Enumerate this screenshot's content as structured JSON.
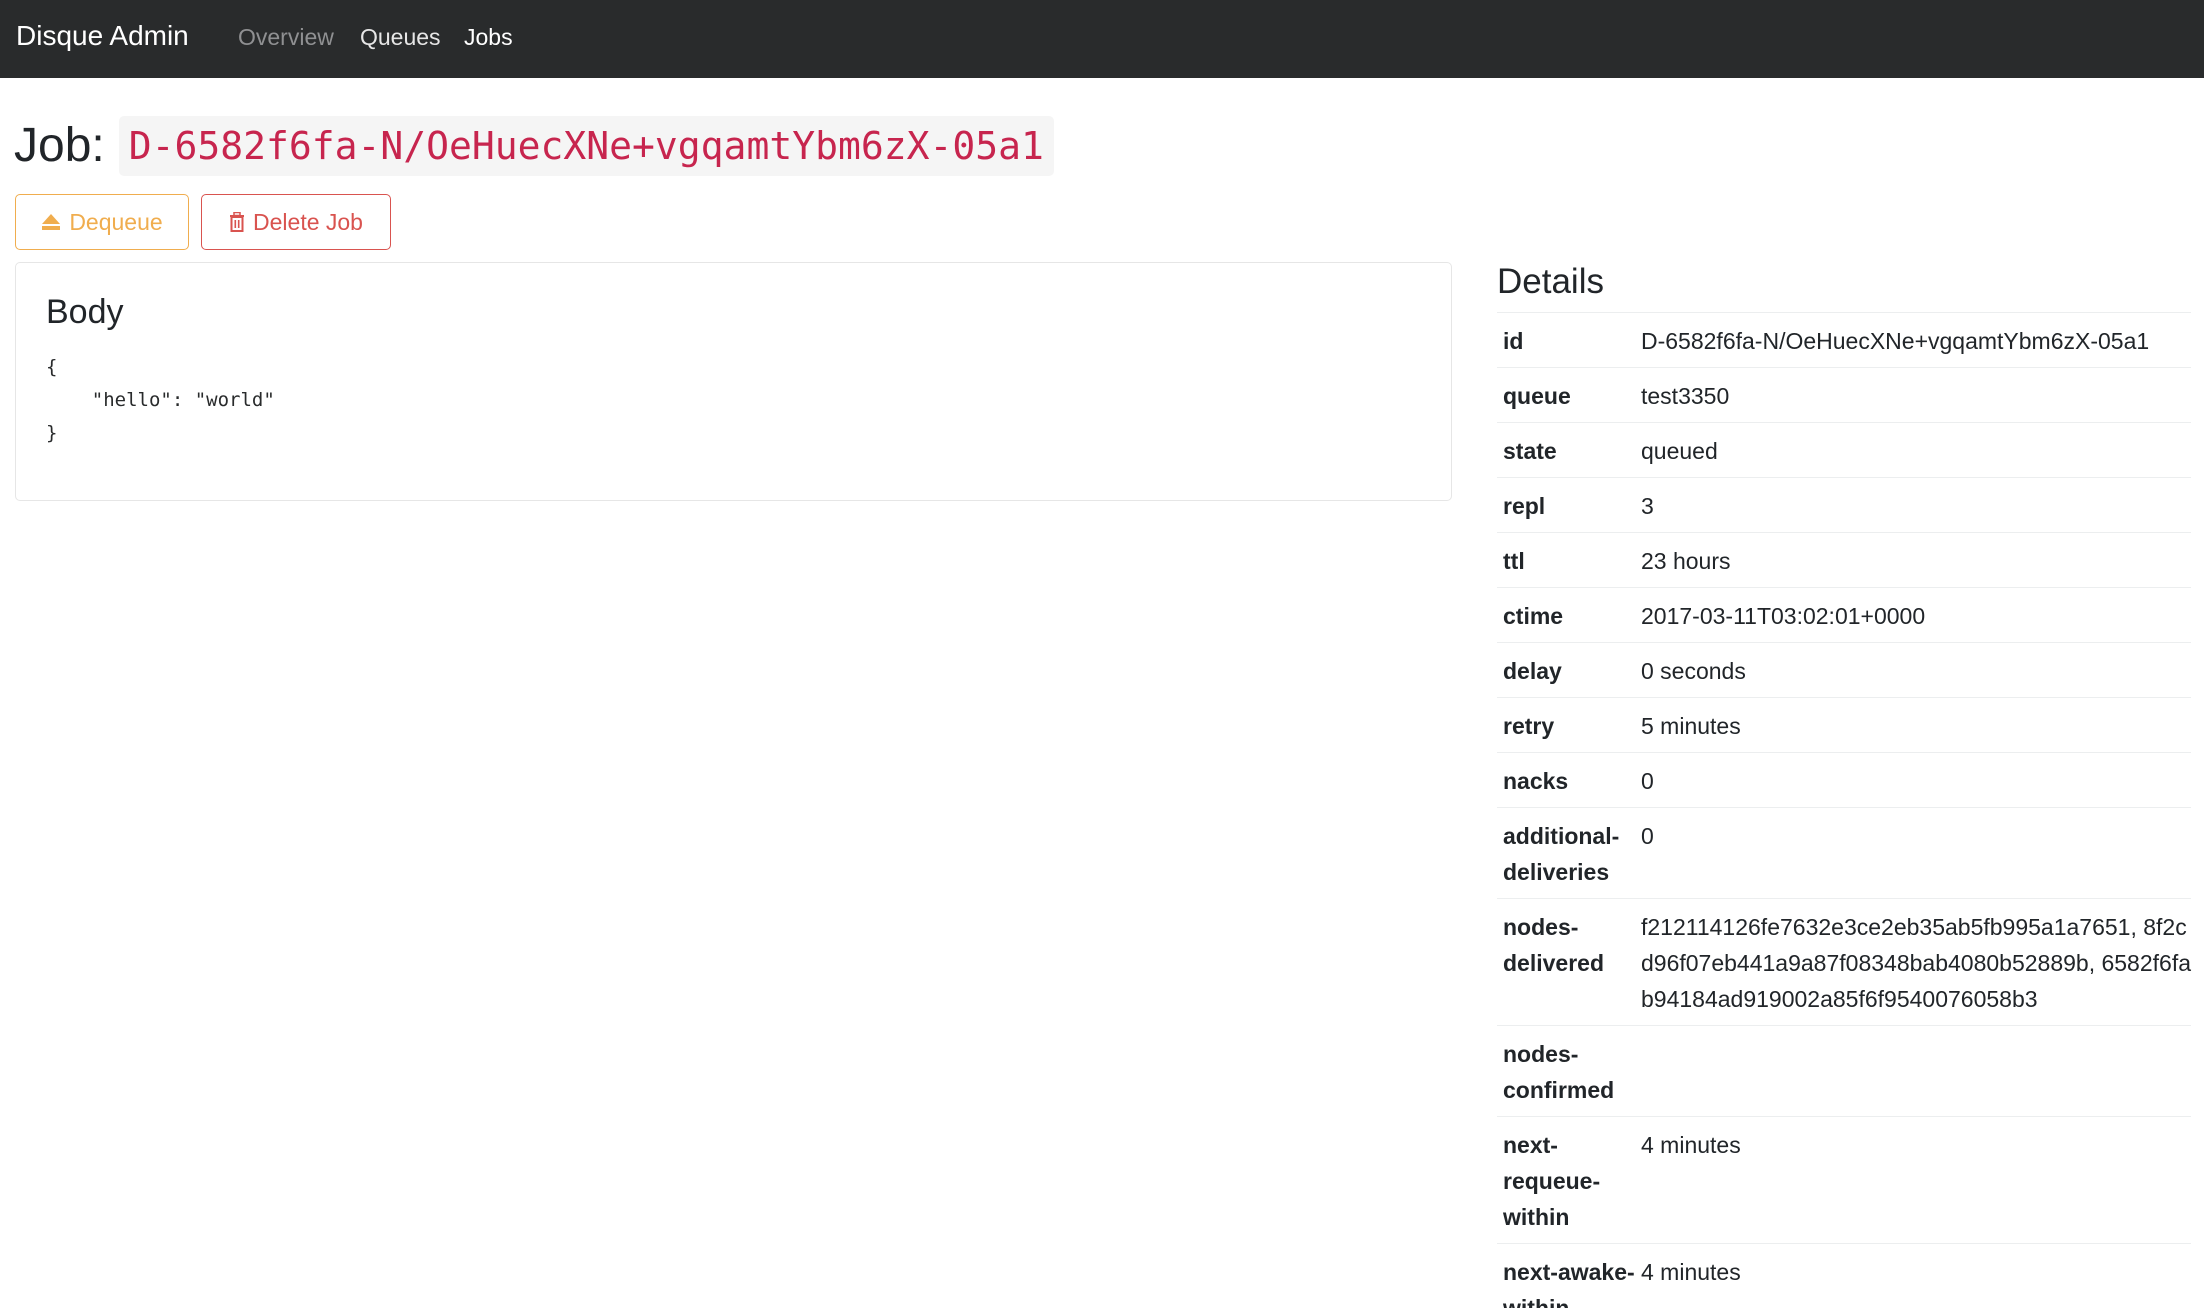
{
  "navbar": {
    "brand": "Disque Admin",
    "links": [
      {
        "label": "Overview"
      },
      {
        "label": "Queues"
      },
      {
        "label": "Jobs"
      }
    ]
  },
  "job": {
    "title_label": "Job:",
    "id": "D-6582f6fa-N/OeHuecXNe+vgqamtYbm6zX-05a1"
  },
  "actions": {
    "dequeue_label": "Dequeue",
    "delete_label": "Delete Job"
  },
  "body_card": {
    "title": "Body",
    "content": "{\n    \"hello\": \"world\"\n}"
  },
  "details": {
    "title": "Details",
    "rows": [
      {
        "key": "id",
        "value": "D-6582f6fa-N/OeHuecXNe+vgqamtYbm6zX-05a1"
      },
      {
        "key": "queue",
        "value": "test3350"
      },
      {
        "key": "state",
        "value": "queued"
      },
      {
        "key": "repl",
        "value": "3"
      },
      {
        "key": "ttl",
        "value": "23 hours"
      },
      {
        "key": "ctime",
        "value": "2017-03-11T03:02:01+0000"
      },
      {
        "key": "delay",
        "value": "0 seconds"
      },
      {
        "key": "retry",
        "value": "5 minutes"
      },
      {
        "key": "nacks",
        "value": "0"
      },
      {
        "key": "additional-deliveries",
        "value": "0"
      },
      {
        "key": "nodes-delivered",
        "value": "f212114126fe7632e3ce2eb35ab5fb995a1a7651, 8f2cd96f07eb441a9a87f08348bab4080b52889b, 6582f6fab94184ad919002a85f6f9540076058b3"
      },
      {
        "key": "nodes-confirmed",
        "value": ""
      },
      {
        "key": "next-requeue-within",
        "value": "4 minutes"
      },
      {
        "key": "next-awake-within",
        "value": "4 minutes"
      }
    ]
  },
  "colors": {
    "navbar_bg": "#292b2c",
    "warning": "#f0ad4e",
    "danger": "#d9534f",
    "code": "#c7254e"
  },
  "icons": {
    "dequeue": "eject-icon",
    "delete": "trash-icon"
  }
}
